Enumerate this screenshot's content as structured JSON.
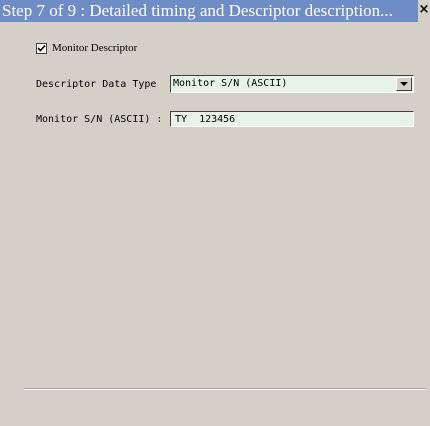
{
  "window": {
    "title": "Step 7 of 9 : Detailed timing and Descriptor description...",
    "close_glyph": "×",
    "close_icon": "close-icon"
  },
  "form": {
    "monitor_descriptor": {
      "label": "Monitor Descriptor",
      "checked": true
    },
    "descriptor_data_type": {
      "label": "Descriptor Data Type",
      "selected": "Monitor S/N (ASCII)",
      "dropdown_icon": "chevron-down-icon"
    },
    "monitor_sn": {
      "label": "Monitor S/N (ASCII) :",
      "value": "TY  123456"
    }
  },
  "colors": {
    "titlebar": "#6e8dc6",
    "window_bg": "#d4d0c8",
    "field_bg": "#e6f3e6"
  }
}
